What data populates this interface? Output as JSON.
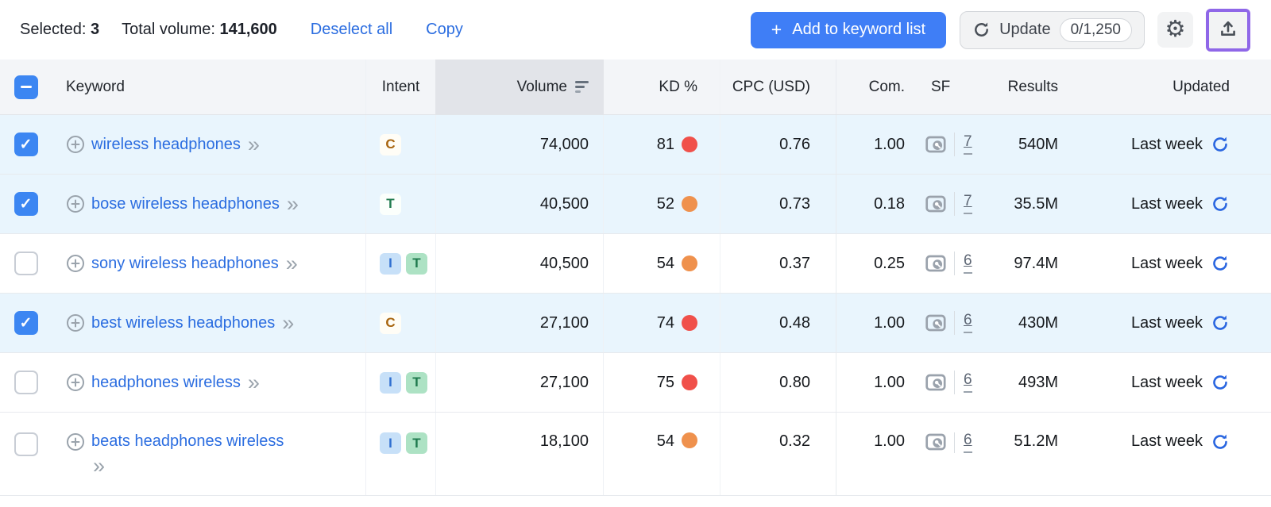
{
  "toolbar": {
    "selected_label": "Selected:",
    "selected_count": "3",
    "total_volume_label": "Total volume:",
    "total_volume_value": "141,600",
    "deselect_all_label": "Deselect all",
    "copy_label": "Copy",
    "add_plus_glyph": "+",
    "add_button_label": "Add to keyword list",
    "update_label": "Update",
    "update_quota": "0/1,250"
  },
  "icons": {
    "gear_glyph": "⚙",
    "chevron_glyph": "»"
  },
  "colors": {
    "link_blue": "#2b6de0",
    "add_button_blue": "#3f7ef6",
    "selected_row_bg": "#e9f5fd",
    "header_bg": "#f3f5f8",
    "sorted_column_bg": "#e2e4e9",
    "kd_red": "#f0504a",
    "kd_orange": "#ef914d",
    "export_highlight_purple": "#8f67e8",
    "refresh_blue": "#2a66e0"
  },
  "table": {
    "headers": {
      "keyword": "Keyword",
      "intent": "Intent",
      "volume": "Volume",
      "kd": "KD %",
      "cpc": "CPC (USD)",
      "com": "Com.",
      "sf": "SF",
      "results": "Results",
      "updated": "Updated"
    },
    "rows": [
      {
        "checkbox": "cb checked",
        "keyword": "wireless headphones",
        "badges": [
          {
            "label": "C",
            "css": "intent-badge c"
          }
        ],
        "volume": "74,000",
        "kd": "81",
        "kd_dot": "kd-dot red",
        "cpc": "0.76",
        "com": "1.00",
        "sf": "7",
        "results": "540M",
        "updated": "Last week"
      },
      {
        "checkbox": "cb checked",
        "keyword": "bose wireless headphones",
        "badges": [
          {
            "label": "T",
            "css": "intent-badge t"
          }
        ],
        "volume": "40,500",
        "kd": "52",
        "kd_dot": "kd-dot orange",
        "cpc": "0.73",
        "com": "0.18",
        "sf": "7",
        "results": "35.5M",
        "updated": "Last week"
      },
      {
        "checkbox": "cb",
        "keyword": "sony wireless headphones",
        "badges": [
          {
            "label": "I",
            "css": "intent-badge i"
          },
          {
            "label": "T",
            "css": "intent-badge t"
          }
        ],
        "volume": "40,500",
        "kd": "54",
        "kd_dot": "kd-dot orange",
        "cpc": "0.37",
        "com": "0.25",
        "sf": "6",
        "results": "97.4M",
        "updated": "Last week"
      },
      {
        "checkbox": "cb checked",
        "keyword": "best wireless headphones",
        "badges": [
          {
            "label": "C",
            "css": "intent-badge c"
          }
        ],
        "volume": "27,100",
        "kd": "74",
        "kd_dot": "kd-dot red",
        "cpc": "0.48",
        "com": "1.00",
        "sf": "6",
        "results": "430M",
        "updated": "Last week"
      },
      {
        "checkbox": "cb",
        "keyword": "headphones wireless",
        "badges": [
          {
            "label": "I",
            "css": "intent-badge i"
          },
          {
            "label": "T",
            "css": "intent-badge t"
          }
        ],
        "volume": "27,100",
        "kd": "75",
        "kd_dot": "kd-dot red",
        "cpc": "0.80",
        "com": "1.00",
        "sf": "6",
        "results": "493M",
        "updated": "Last week"
      },
      {
        "checkbox": "cb",
        "keyword": "beats headphones wireless",
        "badges": [
          {
            "label": "I",
            "css": "intent-badge i"
          },
          {
            "label": "T",
            "css": "intent-badge t"
          }
        ],
        "volume": "18,100",
        "kd": "54",
        "kd_dot": "kd-dot orange",
        "cpc": "0.32",
        "com": "1.00",
        "sf": "6",
        "results": "51.2M",
        "updated": "Last week"
      }
    ]
  }
}
